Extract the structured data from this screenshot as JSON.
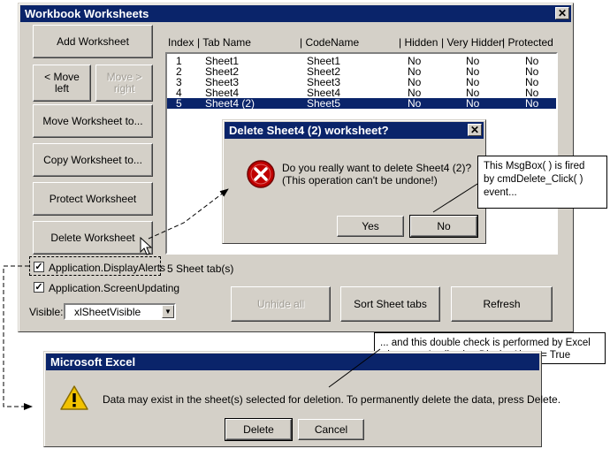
{
  "main_window": {
    "title": "Workbook Worksheets",
    "buttons": {
      "add": "Add Worksheet",
      "move_left": "< Move left",
      "move_right": "Move > right",
      "move_to": "Move Worksheet to...",
      "copy_to": "Copy Worksheet to...",
      "protect": "Protect Worksheet",
      "delete": "Delete Worksheet",
      "unhide_all": "Unhide all",
      "sort": "Sort Sheet tabs",
      "refresh": "Refresh"
    },
    "columns": [
      "Index",
      "| Tab Name",
      "| CodeName",
      "| Hidden",
      "| Very Hidden",
      "| Protected"
    ],
    "rows": [
      {
        "index": "1",
        "tab": "Sheet1",
        "code": "Sheet1",
        "hidden": "No",
        "very_hidden": "No",
        "protected": "No",
        "selected": false
      },
      {
        "index": "2",
        "tab": "Sheet2",
        "code": "Sheet2",
        "hidden": "No",
        "very_hidden": "No",
        "protected": "No",
        "selected": false
      },
      {
        "index": "3",
        "tab": "Sheet3",
        "code": "Sheet3",
        "hidden": "No",
        "very_hidden": "No",
        "protected": "No",
        "selected": false
      },
      {
        "index": "4",
        "tab": "Sheet4",
        "code": "Sheet4",
        "hidden": "No",
        "very_hidden": "No",
        "protected": "No",
        "selected": false
      },
      {
        "index": "5",
        "tab": "Sheet4 (2)",
        "code": "Sheet5",
        "hidden": "No",
        "very_hidden": "No",
        "protected": "No",
        "selected": true
      }
    ],
    "display_alerts_label": "Application.DisplayAlerts",
    "screen_updating_label": "Application.ScreenUpdating",
    "sheet_count": "5 Sheet tab(s)",
    "visible_label": "Visible:",
    "visible_value": "xlSheetVisible"
  },
  "delete_dialog": {
    "title": "Delete Sheet4 (2) worksheet?",
    "message_line1": "Do you really want to delete Sheet4 (2)?",
    "message_line2": "(This operation can't be undone!)",
    "yes": "Yes",
    "no": "No"
  },
  "callout1": {
    "line1": "This MsgBox( ) is fired",
    "line2": "by cmdDelete_Click( )",
    "line3": "event..."
  },
  "callout2": {
    "line1": "... and this double check is performed by Excel",
    "line2": "whenever Application.DisplayAlerts = True"
  },
  "excel_dialog": {
    "title": "Microsoft Excel",
    "message": "Data may exist in the sheet(s) selected for deletion. To permanently delete the data, press Delete.",
    "delete": "Delete",
    "cancel": "Cancel"
  },
  "colors": {
    "titlebar": "#0a246a",
    "face": "#d4d0c8",
    "selection": "#0a246a",
    "error_icon": "#c00000",
    "warning_icon": "#f2c200"
  }
}
